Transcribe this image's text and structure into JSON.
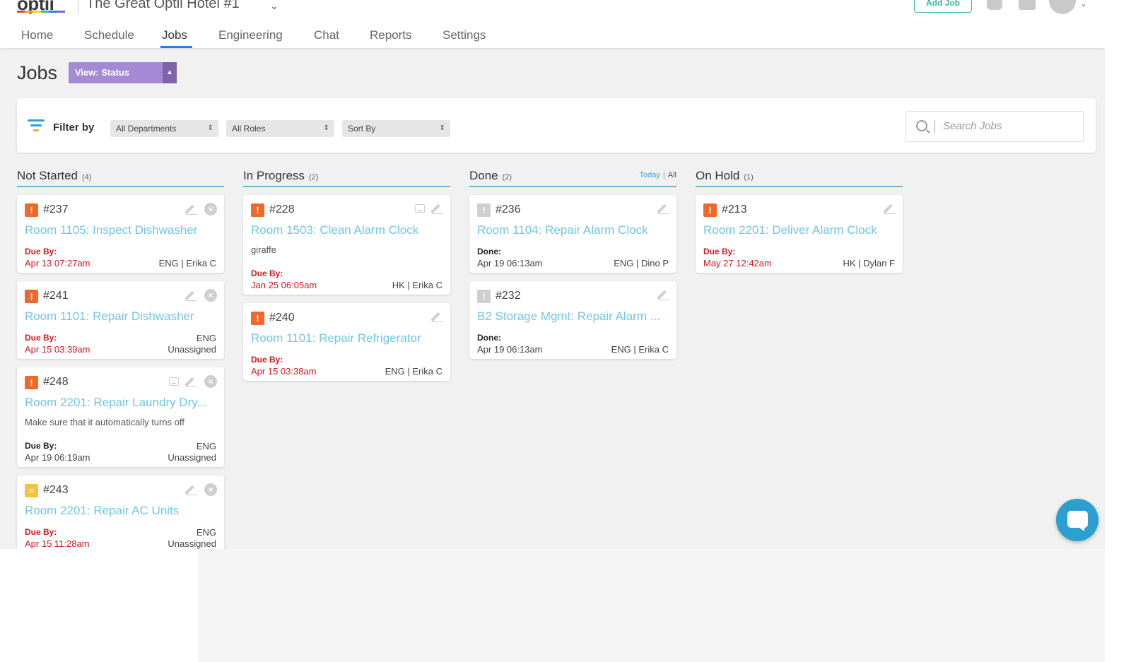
{
  "header": {
    "logo": "optii",
    "hotel_name": "The Great Optii Hotel #1",
    "add_job_label": "Add Job"
  },
  "nav": {
    "items": [
      "Home",
      "Schedule",
      "Jobs",
      "Engineering",
      "Chat",
      "Reports",
      "Settings"
    ],
    "active": "Jobs"
  },
  "page": {
    "title": "Jobs",
    "view_select": "View: Status"
  },
  "filters": {
    "label": "Filter by",
    "departments": "All Departments",
    "roles": "All Roles",
    "sort": "Sort By",
    "search_placeholder": "Search Jobs"
  },
  "colors": {
    "priority_high": "#ef6a2a",
    "priority_medium": "#f6c33b",
    "priority_done": "#cfcfcf",
    "accent_blue": "#2d7dd2",
    "title_link": "#72c6e3",
    "due_red": "#d0191f",
    "view_purple": "#a48ad4"
  },
  "columns": [
    {
      "title": "Not Started",
      "count": "(4)",
      "cards": [
        {
          "id": "#237",
          "priority": "!",
          "title": "Room 1105: Inspect Dishwasher",
          "due_label": "Due By:",
          "due_date": "Apr 13 07:27am",
          "assign": "ENG | Erika C"
        },
        {
          "id": "#241",
          "priority": "!",
          "title": "Room 1101: Repair Dishwasher",
          "due_label": "Due By:",
          "due_date": "Apr 15 03:39am",
          "assign_dept": "ENG",
          "assign": "Unassigned"
        },
        {
          "id": "#248",
          "priority": "!",
          "title": "Room 2201: Repair Laundry Dry...",
          "desc": "Make sure that it automatically turns off",
          "due_label": "Due By:",
          "due_date": "Apr 19 06:19am",
          "assign_dept": "ENG",
          "assign": "Unassigned"
        },
        {
          "id": "#243",
          "priority": "=",
          "title": "Room 2201: Repair AC Units",
          "due_label": "Due By:",
          "due_date": "Apr 15 11:28am",
          "assign_dept": "ENG",
          "assign": "Unassigned"
        }
      ]
    },
    {
      "title": "In Progress",
      "count": "(2)",
      "cards": [
        {
          "id": "#228",
          "priority": "!",
          "title": "Room 1503: Clean Alarm Clock",
          "desc": "giraffe",
          "due_label": "Due By:",
          "due_date": "Jan 25 06:05am",
          "assign": "HK | Erika C"
        },
        {
          "id": "#240",
          "priority": "!",
          "title": "Room 1101: Repair Refrigerator",
          "due_label": "Due By:",
          "due_date": "Apr 15 03:38am",
          "assign": "ENG | Erika C"
        }
      ]
    },
    {
      "title": "Done",
      "count": "(2)",
      "filter_today": "Today",
      "filter_all": "All",
      "cards": [
        {
          "id": "#236",
          "priority": "!",
          "title": "Room 1104: Repair Alarm Clock",
          "due_label": "Done:",
          "due_date": "Apr 19 06:13am",
          "assign": "ENG | Dino P"
        },
        {
          "id": "#232",
          "priority": "!",
          "title": "B2 Storage Mgmt: Repair Alarm ...",
          "due_label": "Done:",
          "due_date": "Apr 19 06:13am",
          "assign": "ENG | Erika C"
        }
      ]
    },
    {
      "title": "On Hold",
      "count": "(1)",
      "cards": [
        {
          "id": "#213",
          "priority": "!",
          "title": "Room 2201: Deliver Alarm Clock",
          "due_label": "Due By:",
          "due_date": "May 27 12:42am",
          "assign": "HK | Dylan F"
        }
      ]
    }
  ]
}
